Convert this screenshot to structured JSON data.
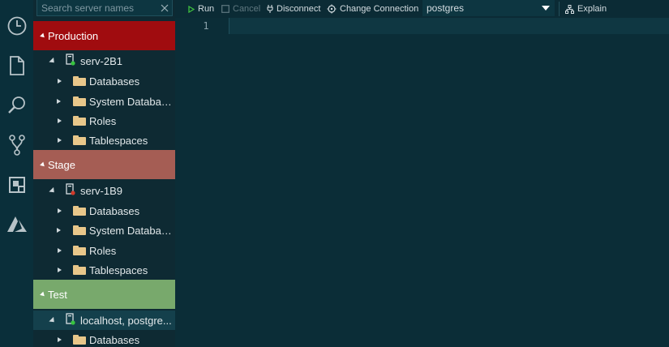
{
  "sidebar": {
    "search_placeholder": "Search server names",
    "groups": [
      {
        "label": "Production",
        "color": "#a00c0f",
        "server": {
          "label": "serv-2B1",
          "status_color": "#37c43f"
        },
        "folders": [
          "Databases",
          "System Databas...",
          "Roles",
          "Tablespaces"
        ]
      },
      {
        "label": "Stage",
        "color": "#a55d54",
        "server": {
          "label": "serv-1B9",
          "status_color": "#d23a2a"
        },
        "folders": [
          "Databases",
          "System Databas...",
          "Roles",
          "Tablespaces"
        ]
      },
      {
        "label": "Test",
        "color": "#78a96c",
        "server": {
          "label": "localhost, postgre...",
          "status_color": "#37c43f"
        },
        "folders": [
          "Databases"
        ]
      }
    ]
  },
  "toolbar": {
    "run": "Run",
    "cancel": "Cancel",
    "disconnect": "Disconnect",
    "change_connection": "Change Connection",
    "database": "postgres",
    "explain": "Explain",
    "run_color": "#3fbf3f"
  },
  "editor": {
    "line_numbers": [
      "1"
    ]
  }
}
